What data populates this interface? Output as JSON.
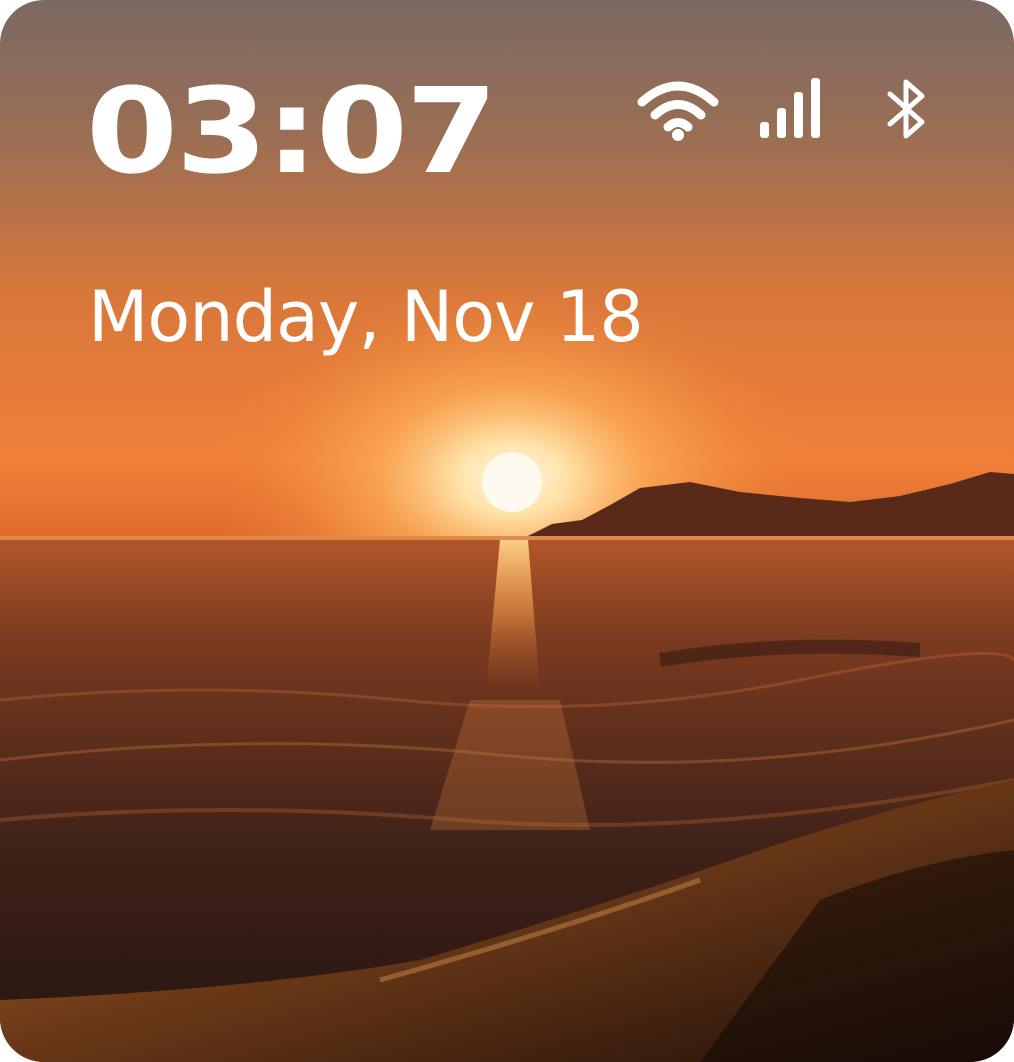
{
  "lockscreen": {
    "time": "03:07",
    "date": "Monday, Nov 18"
  },
  "status_bar": {
    "icons": [
      "wifi-icon",
      "cellular-signal-icon",
      "bluetooth-icon"
    ]
  },
  "wallpaper": {
    "subject": "sunset-over-sea-beach",
    "colors": {
      "sky_top": "#7e6a62",
      "sky_glow": "#f5893a",
      "sun": "#fff4d8",
      "sea": "#3a2218",
      "sand": "#5a3116"
    }
  }
}
